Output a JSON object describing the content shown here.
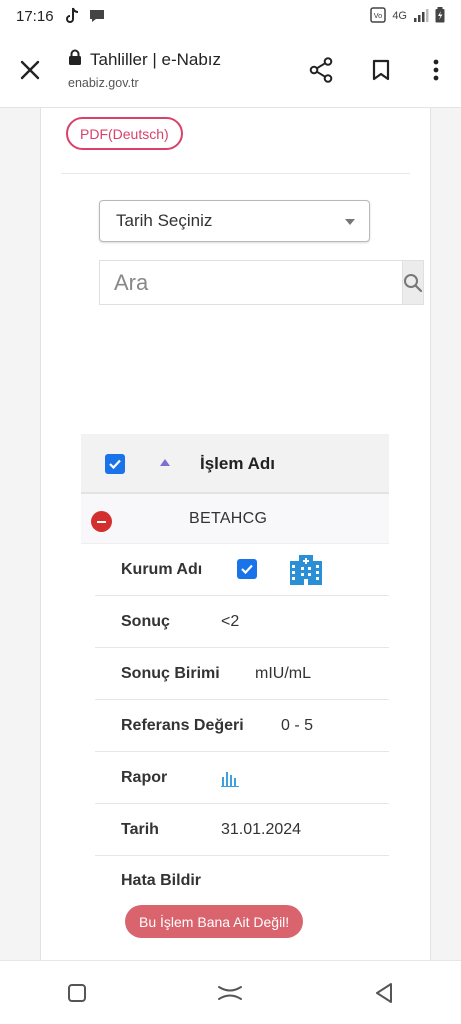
{
  "status_bar": {
    "time": "17:16",
    "network_label": "4G"
  },
  "browser": {
    "tab_title": "Tahliller | e-Nabız",
    "url": "enabiz.gov.tr"
  },
  "page": {
    "pdf_button": "PDF(Deutsch)",
    "date_select": {
      "selected": "Tarih Seçiniz"
    },
    "search": {
      "placeholder": "Ara",
      "value": ""
    },
    "table": {
      "header_label": "İşlem Adı",
      "header_checked": true,
      "rows": [
        {
          "name": "BETAHCG",
          "expanded": true,
          "details": {
            "kurum_adi_label": "Kurum Adı",
            "sonuc_label": "Sonuç",
            "sonuc_value": "<2",
            "sonuc_birimi_label": "Sonuç Birimi",
            "sonuc_birimi_value": "mIU/mL",
            "referans_label": "Referans Değeri",
            "referans_value": "0 - 5",
            "rapor_label": "Rapor",
            "tarih_label": "Tarih",
            "tarih_value": "31.01.2024",
            "hata_label": "Hata Bildir",
            "hata_button": "Bu İşlem Bana Ait Değil!"
          }
        }
      ]
    }
  },
  "colors": {
    "accent_pink": "#d9416b",
    "checkbox_blue": "#1a73e8",
    "error_red": "#d32f2f",
    "report_button": "#d9646e",
    "hospital_icon": "#2b8fd6"
  }
}
